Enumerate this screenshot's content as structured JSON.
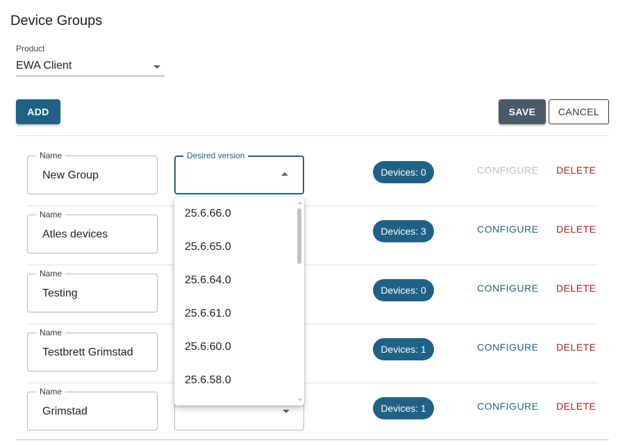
{
  "page": {
    "title": "Device Groups"
  },
  "product": {
    "label": "Product",
    "value": "EWA Client"
  },
  "toolbar": {
    "add_label": "ADD",
    "save_label": "SAVE",
    "cancel_label": "CANCEL"
  },
  "field_labels": {
    "name": "Name",
    "desired_version": "Desired version"
  },
  "groups": [
    {
      "name": "New Group",
      "version": "",
      "devices": "Devices: 0",
      "configure": "CONFIGURE",
      "delete": "DELETE",
      "configure_enabled": false
    },
    {
      "name": "Atles devices",
      "version": "",
      "devices": "Devices: 3",
      "configure": "CONFIGURE",
      "delete": "DELETE",
      "configure_enabled": true
    },
    {
      "name": "Testing",
      "version": "",
      "devices": "Devices: 0",
      "configure": "CONFIGURE",
      "delete": "DELETE",
      "configure_enabled": true
    },
    {
      "name": "Testbrett Grimstad",
      "version": "",
      "devices": "Devices: 1",
      "configure": "CONFIGURE",
      "delete": "DELETE",
      "configure_enabled": true
    },
    {
      "name": "Grimstad",
      "version": "",
      "devices": "Devices: 1",
      "configure": "CONFIGURE",
      "delete": "DELETE",
      "configure_enabled": true
    }
  ],
  "version_dropdown": {
    "open_for_group": "New Group",
    "options": [
      "25.6.66.0",
      "25.6.65.0",
      "25.6.64.0",
      "25.6.61.0",
      "25.6.60.0",
      "25.6.58.0"
    ]
  },
  "colors": {
    "primary": "#1f6285",
    "save_button": "#4a5a66",
    "delete": "#b71c1c",
    "disabled": "#bdbdbd"
  },
  "icons": {
    "select_caret": "caret-down-icon",
    "open_caret": "caret-up-icon"
  }
}
